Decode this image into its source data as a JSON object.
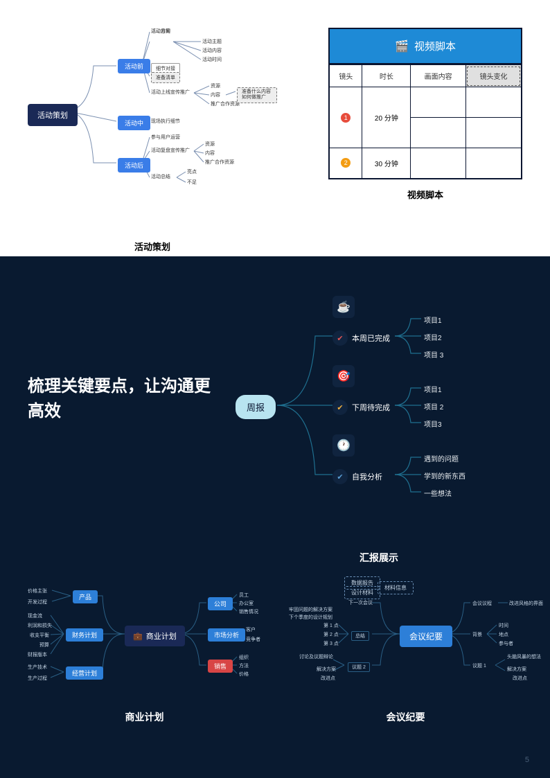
{
  "page_number": "5",
  "top": {
    "mindmap": {
      "root": "活动策划",
      "caption": "活动策划",
      "nodes": {
        "n1": "活动前",
        "n2": "活动中",
        "n3": "活动后"
      },
      "leaves": {
        "l1": "活动目的",
        "l2": "活动方案",
        "l3": "活动主题",
        "l4": "活动内容",
        "l5": "活动时间",
        "l6": "细节对接",
        "l7": "准备清单",
        "l8": "活动上线宣传推广",
        "l9": "资源",
        "l10": "内容",
        "l11": "推广合作资源",
        "l12": "准备什么内容\n如何做推广",
        "l13": "现场执行细节",
        "l14": "参与用户运营",
        "l15": "活动复盘宣传推广",
        "l16": "资源",
        "l17": "内容",
        "l18": "推广合作资源",
        "l19": "活动总结",
        "l20": "亮点",
        "l21": "不足"
      }
    },
    "video_table": {
      "header": "视频脚本",
      "caption": "视频脚本",
      "cols": [
        "镜头",
        "时长",
        "画面内容",
        "镜头变化"
      ],
      "rows": [
        {
          "num": "1",
          "dur": "20 分钟"
        },
        {
          "num": "2",
          "dur": "30 分钟"
        }
      ]
    }
  },
  "hero": {
    "heading": "梳理关键要点，让沟通更高效",
    "root": "周报",
    "caption": "汇报展示",
    "branches": [
      {
        "label": "本周已完成",
        "items": [
          "项目1",
          "项目2",
          "项目 3"
        ]
      },
      {
        "label": "下周待完成",
        "items": [
          "项目1",
          "项目 2",
          "项目3"
        ]
      },
      {
        "label": "自我分析",
        "items": [
          "遇到的问题",
          "学到的新东西",
          "一些想法"
        ]
      }
    ]
  },
  "business": {
    "caption": "商业计划",
    "root": "商业计划",
    "left": {
      "产品": [
        "价格主张",
        "开发过程"
      ],
      "财务计划": [
        "现金流",
        "利润和损失",
        "收支平衡",
        "预算",
        "财报版本"
      ],
      "经营计划": [
        "生产技术",
        "生产过程"
      ]
    },
    "right": {
      "公司": [
        "员工",
        "办公室",
        "销售情况"
      ],
      "市场分析": [
        "客户",
        "竞争者"
      ],
      "销售": [
        "组织",
        "方法",
        "价格"
      ]
    }
  },
  "meeting": {
    "caption": "会议纪要",
    "root": "会议纪要",
    "prep": [
      "数据报告",
      "设计材料",
      "材料信息"
    ],
    "toplabel": "下一次会议",
    "leftlabels": [
      "牢固问题的解决方案",
      "下个季度的设计规划"
    ],
    "summary": {
      "label": "总结",
      "items": [
        "第 1 点",
        "第 2 点",
        "第 3 点"
      ]
    },
    "issue": {
      "label": "议题 2",
      "top": "讨论及议题辩论",
      "items": [
        "解决方案",
        "改进点"
      ]
    },
    "agenda": {
      "label": "会议议程",
      "note": "改进风格的界面"
    },
    "bg": {
      "label": "背景",
      "items": [
        "时间",
        "地点",
        "参与者"
      ]
    },
    "issue1": {
      "label": "议题 1",
      "top": "头脑风暴的想法",
      "items": [
        "解决方案",
        "改进点"
      ]
    }
  }
}
